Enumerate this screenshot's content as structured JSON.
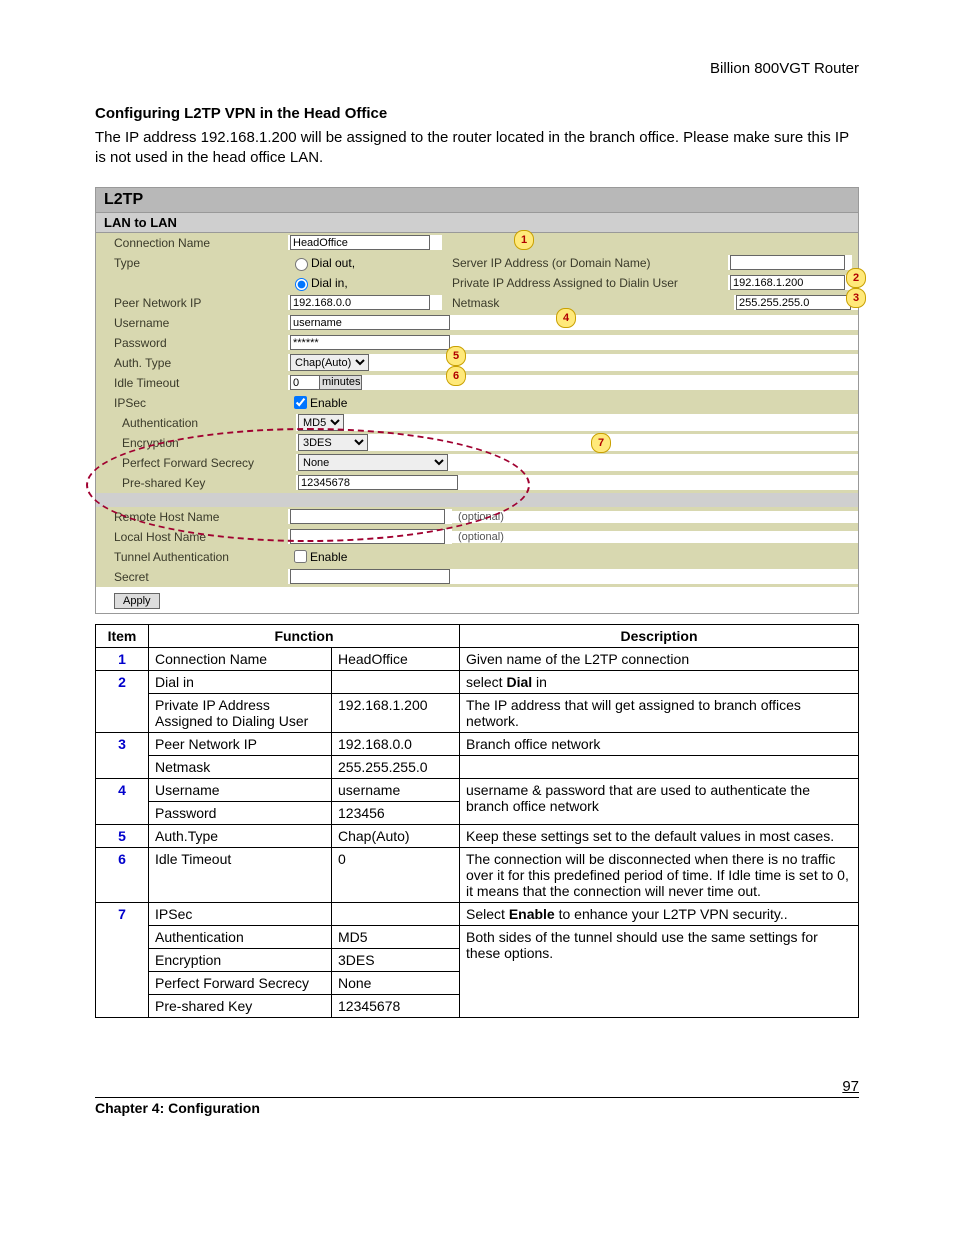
{
  "header": {
    "product": "Billion 800VGT Router"
  },
  "section": {
    "title": "Configuring L2TP VPN in the Head Office",
    "intro": "The IP address 192.168.1.200 will be assigned to the router located in the branch office. Please make sure this IP is not used in the head office LAN."
  },
  "panel": {
    "title": "L2TP",
    "subtitle": "LAN to LAN",
    "fields": {
      "connection_name_label": "Connection Name",
      "connection_name_value": "HeadOffice",
      "type_label": "Type",
      "dial_out_label": "Dial out,",
      "dial_in_label": "Dial in,",
      "server_ip_label": "Server IP Address (or Domain Name)",
      "server_ip_value": "",
      "private_ip_label": "Private IP Address Assigned to Dialin User",
      "private_ip_value": "192.168.1.200",
      "peer_network_label": "Peer Network IP",
      "peer_network_value": "192.168.0.0",
      "netmask_label": "Netmask",
      "netmask_value": "255.255.255.0",
      "username_label": "Username",
      "username_value": "username",
      "password_label": "Password",
      "password_value": "******",
      "auth_type_label": "Auth. Type",
      "auth_type_value": "Chap(Auto)",
      "idle_timeout_label": "Idle Timeout",
      "idle_timeout_value": "0",
      "idle_timeout_unit": "minutes",
      "ipsec_label": "IPSec",
      "ipsec_enable_label": "Enable",
      "authentication_label": "Authentication",
      "authentication_value": "MD5",
      "encryption_label": "Encryption",
      "encryption_value": "3DES",
      "pfs_label": "Perfect Forward Secrecy",
      "pfs_value": "None",
      "psk_label": "Pre-shared Key",
      "psk_value": "12345678",
      "remote_host_label": "Remote Host Name",
      "remote_host_value": "",
      "optional_text": "(optional)",
      "local_host_label": "Local Host Name",
      "local_host_value": "",
      "tunnel_auth_label": "Tunnel Authentication",
      "tunnel_auth_enable_label": "Enable",
      "secret_label": "Secret",
      "secret_value": "",
      "apply_label": "Apply"
    },
    "callouts": {
      "c1": "1",
      "c2": "2",
      "c3": "3",
      "c4": "4",
      "c5": "5",
      "c6": "6",
      "c7": "7"
    }
  },
  "table": {
    "headers": {
      "item": "Item",
      "function": "Function",
      "description": "Description"
    },
    "rows": [
      {
        "item": "1",
        "func": "Connection Name",
        "val": "HeadOffice",
        "desc": "Given name of the L2TP connection"
      },
      {
        "item": "2",
        "sub": [
          {
            "func": "Dial in",
            "val": "",
            "desc_html": "select <b>Dial</b> in"
          },
          {
            "func": "Private IP Address Assigned to Dialing User",
            "val": "192.168.1.200",
            "desc": "The IP address that will get assigned to branch offices network."
          }
        ]
      },
      {
        "item": "3",
        "sub": [
          {
            "func": "Peer Network IP",
            "val": "192.168.0.0",
            "desc": "Branch office network"
          },
          {
            "func": "Netmask",
            "val": "255.255.255.0",
            "desc": ""
          }
        ]
      },
      {
        "item": "4",
        "sub": [
          {
            "func": "Username",
            "val": "username"
          },
          {
            "func": "Password",
            "val": "123456"
          }
        ],
        "desc": "username & password that are used to authenticate the branch office network"
      },
      {
        "item": "5",
        "func": "Auth.Type",
        "val": "Chap(Auto)",
        "desc": "Keep these settings set to the default values in most cases."
      },
      {
        "item": "6",
        "func": "Idle Timeout",
        "val": "0",
        "desc": "The connection will be disconnected when there is no traffic over it for this predefined period of time.   If  Idle time is set to 0, it means that the connection will never time out."
      },
      {
        "item": "7",
        "sub": [
          {
            "func": "IPSec",
            "val": "",
            "desc_html": "Select <b>Enable</b> to enhance your L2TP VPN security.."
          },
          {
            "func": "Authentication",
            "val": "MD5"
          },
          {
            "func": "Encryption",
            "val": "3DES"
          },
          {
            "func": "Perfect Forward Secrecy",
            "val": "None"
          },
          {
            "func": "Pre-shared Key",
            "val": "12345678"
          }
        ],
        "desc": "Both sides of the tunnel should use the same settings for these options."
      }
    ]
  },
  "footer": {
    "page": "97",
    "chapter": "Chapter 4: Configuration"
  }
}
